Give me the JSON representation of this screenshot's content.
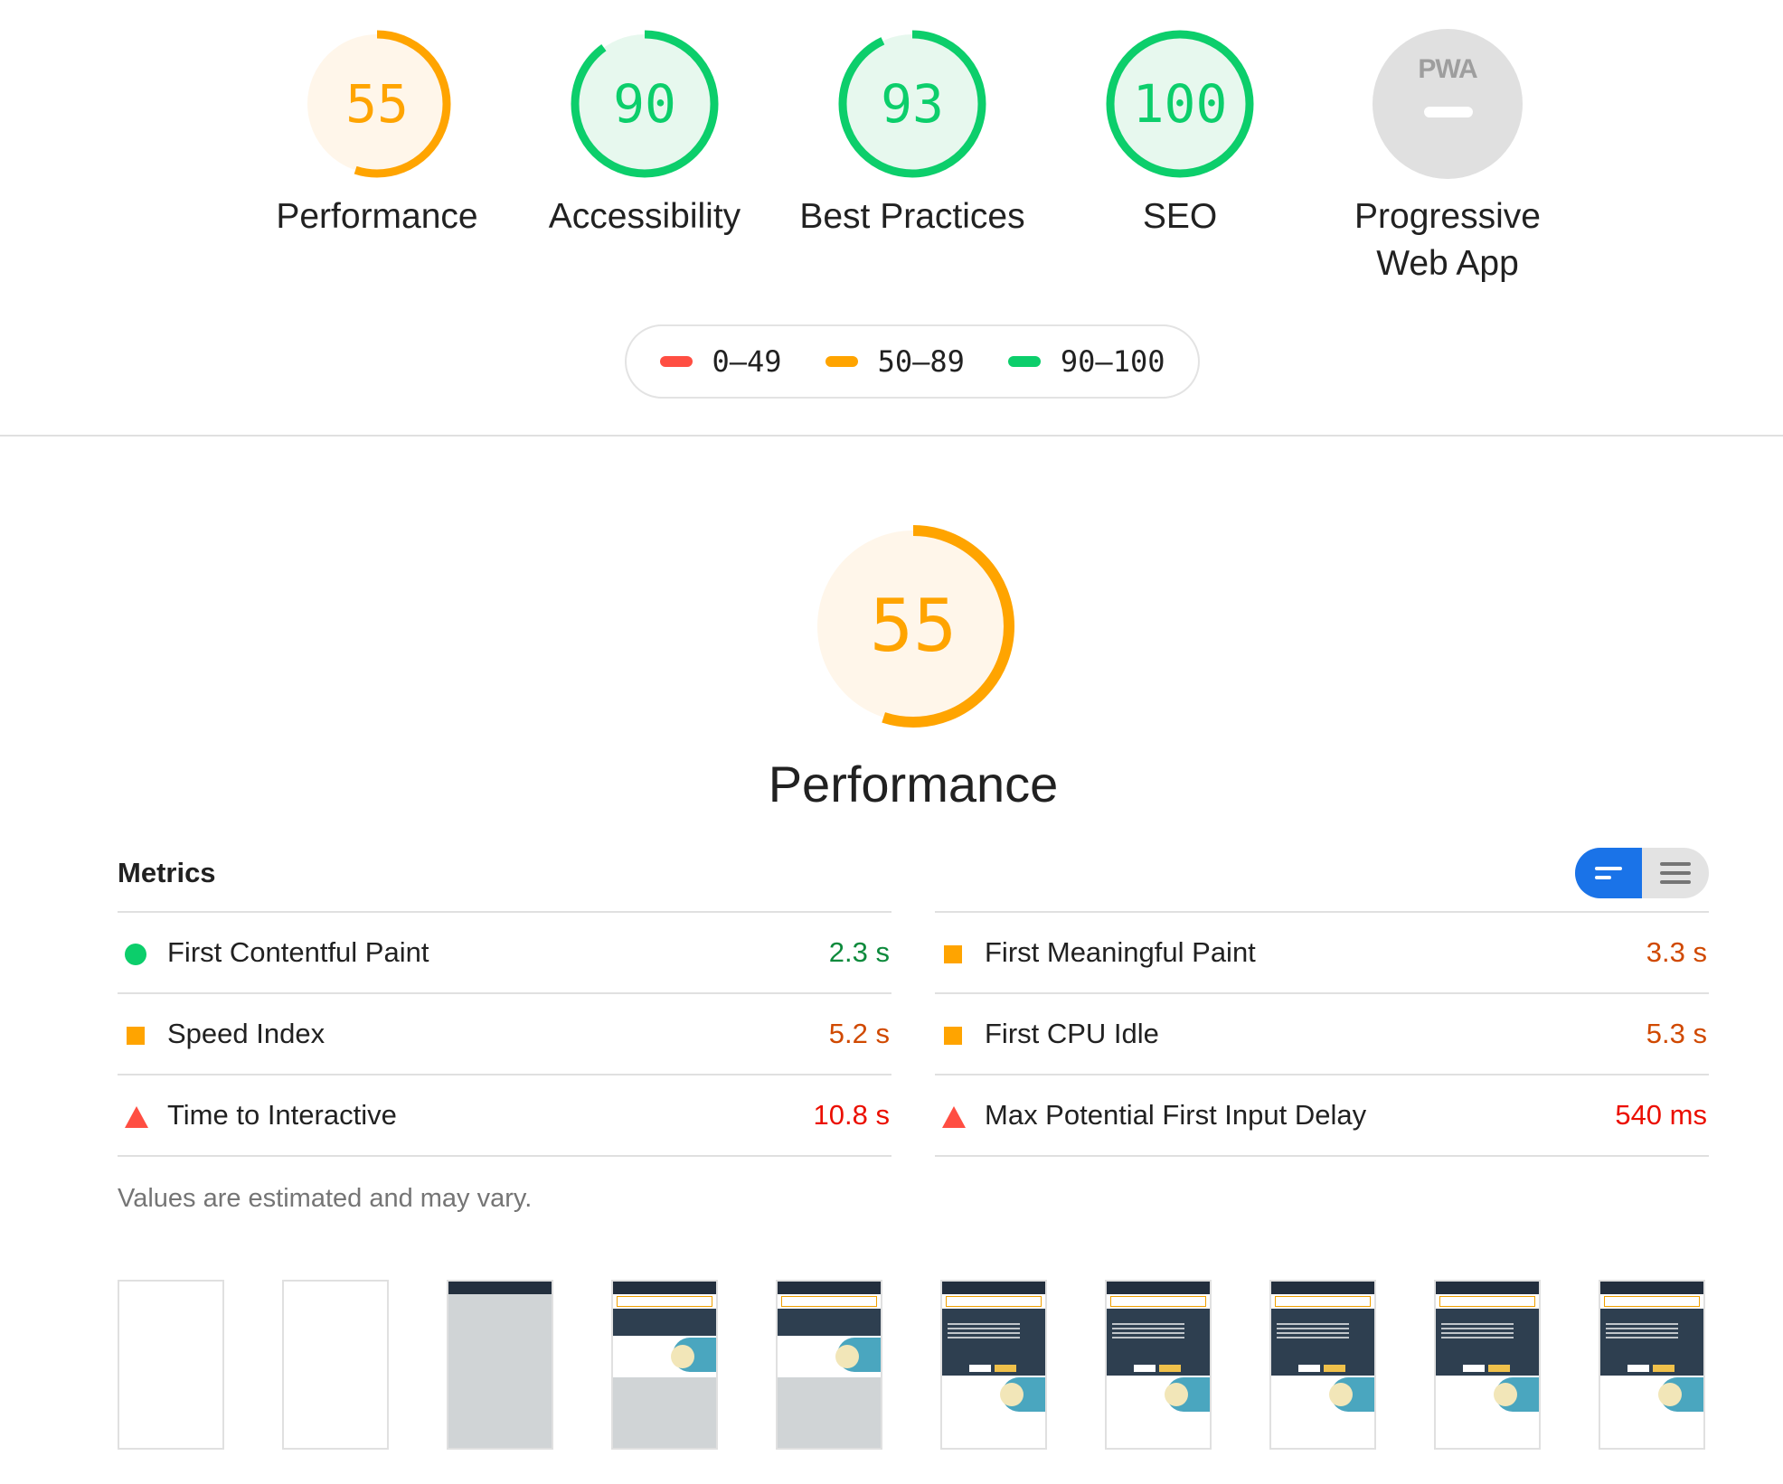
{
  "categories": [
    {
      "id": "performance",
      "label": "Performance",
      "score": "55",
      "score_value": 55,
      "color": "#ffa400",
      "fill": "#fff6ea"
    },
    {
      "id": "accessibility",
      "label": "Accessibility",
      "score": "90",
      "score_value": 90,
      "color": "#0cce6b",
      "fill": "#e7f8ee"
    },
    {
      "id": "best-practices",
      "label": "Best Practices",
      "score": "93",
      "score_value": 93,
      "color": "#0cce6b",
      "fill": "#e7f8ee"
    },
    {
      "id": "seo",
      "label": "SEO",
      "score": "100",
      "score_value": 100,
      "color": "#0cce6b",
      "fill": "#e7f8ee"
    },
    {
      "id": "pwa",
      "label_line1": "Progressive",
      "label_line2": "Web App",
      "badge_text": "PWA"
    }
  ],
  "legend": [
    {
      "label": "0–49",
      "color": "#ff4e42"
    },
    {
      "label": "50–89",
      "color": "#ffa400"
    },
    {
      "label": "90–100",
      "color": "#0cce6b"
    }
  ],
  "performance_section": {
    "score": "55",
    "score_value": 55,
    "title": "Performance",
    "metrics_header": "Metrics",
    "note": "Values are estimated and may vary."
  },
  "metrics": {
    "left": [
      {
        "name": "First Contentful Paint",
        "value": "2.3 s",
        "status": "pass",
        "color": "#0d8a3c"
      },
      {
        "name": "Speed Index",
        "value": "5.2 s",
        "status": "average",
        "color": "#d04900"
      },
      {
        "name": "Time to Interactive",
        "value": "10.8 s",
        "status": "fail",
        "color": "#eb0f00"
      }
    ],
    "right": [
      {
        "name": "First Meaningful Paint",
        "value": "3.3 s",
        "status": "average",
        "color": "#d04900"
      },
      {
        "name": "First CPU Idle",
        "value": "5.3 s",
        "status": "average",
        "color": "#d04900"
      },
      {
        "name": "Max Potential First Input Delay",
        "value": "540 ms",
        "status": "fail",
        "color": "#eb0f00"
      }
    ]
  },
  "filmstrip_frames": 10
}
